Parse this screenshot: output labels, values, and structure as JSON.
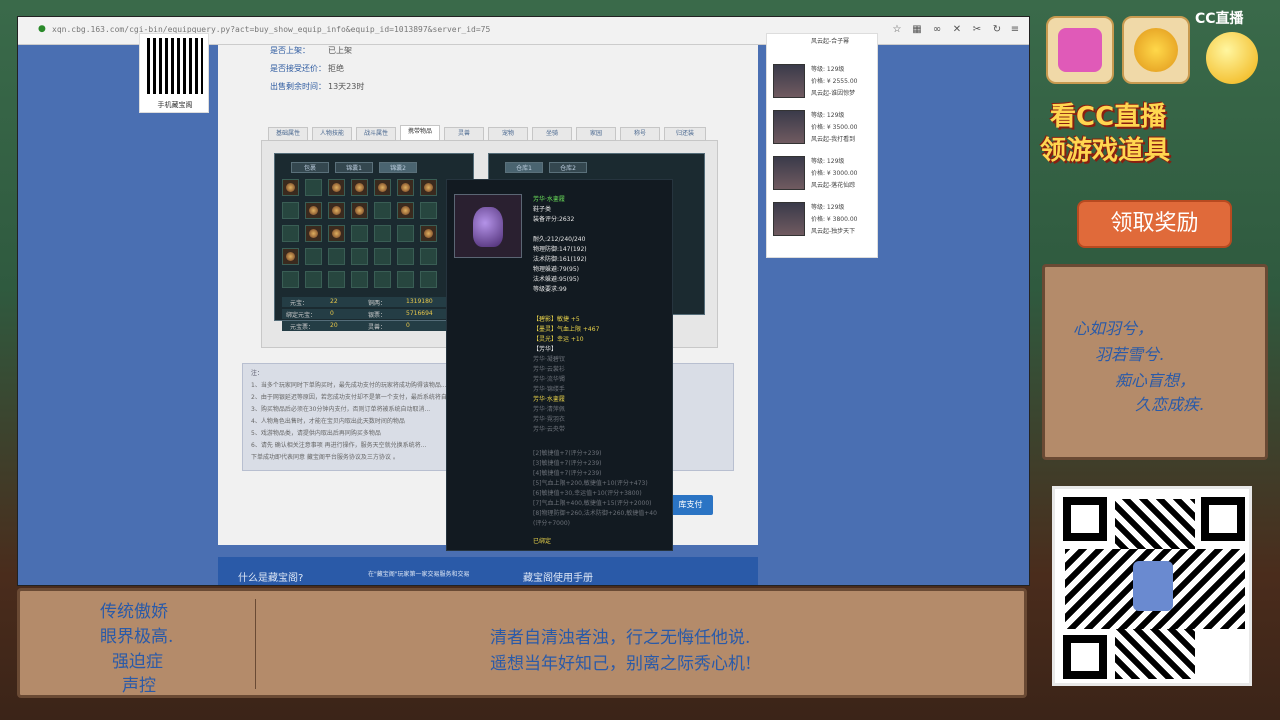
{
  "browser": {
    "url": "xqn.cbg.163.com/cgi-bin/equipquery.py?act=buy_show_equip_info&equip_id=1013897&server_id=75",
    "qr_caption": "手机藏宝阁"
  },
  "sale_info": [
    {
      "key": "是否上架：",
      "value": "已上架"
    },
    {
      "key": "是否接受还价：",
      "value": "拒绝"
    },
    {
      "key": "出售剩余时间：",
      "value": "13天23时"
    }
  ],
  "top_tabs": [
    "基础属性",
    "人物技能",
    "战斗属性",
    "携带物品",
    "灵兽",
    "宠物",
    "坐骑",
    "家园",
    "称号",
    "归还装"
  ],
  "active_tab": "携带物品",
  "inv_tabs": [
    "包裹",
    "锦囊1",
    "锦囊2"
  ],
  "store_tabs": [
    "仓库1",
    "仓库2"
  ],
  "stats": [
    {
      "k1": "元宝：",
      "v1": "22",
      "k2": "铜两：",
      "v2": "1319180"
    },
    {
      "k1": "绑定元宝：",
      "v1": "0",
      "k2": "银票：",
      "v2": "5716694"
    },
    {
      "k1": "元宝票：",
      "v1": "20",
      "k2": "灵兽：",
      "v2": "0"
    }
  ],
  "notes": {
    "title": "注：",
    "lines": [
      "1、当多个玩家同时下单购买时，最先成功支付的玩家将成功购得该物品...",
      "2、由于网银延迟等原因，若您成功支付却不是第一个支付，最后系统将自动退款到您的账户中",
      "3、购买物品后必须在30分钟内支付，否则订单将被系统自动取消...",
      "4、人物角色出售时，才能在宝贝内取出此天数时间的物品",
      "5、戏游物品类，请提供内取出后再同购买多物品",
      "6、请先 确认相关注意事项 再进行操作，服务天空就兑换系统将...",
      "下单成功即代表同意 藏宝阁平台服务协议及三方协议 。"
    ]
  },
  "pay_button": "库支付",
  "bottom_strip": [
    "什么是藏宝阁?",
    "在\"藏宝阁\"玩家第一家交易服务和交易",
    "藏宝阁使用手册"
  ],
  "tooltip": {
    "name": "芳华·水銮履",
    "type": "鞋子类",
    "score": "装备评分:2632",
    "base": [
      "耐久:212/240/240",
      "物理防御:147(192)",
      "法术防御:161(192)",
      "物理躲避:79(95)",
      "法术躲避:95(95)",
      "等级要求:99"
    ],
    "gems": [
      "【碧影】敏捷 +5",
      "【墨灵】气血上限 +467",
      "【灵光】幸运 +10"
    ],
    "set_title": "【芳华】",
    "set_items": [
      "芳华·凝碧钗",
      "芳华·云裳衫",
      "芳华·流华镯",
      "芳华·锦缕手",
      "芳华·水銮履",
      "芳华·清萍佩",
      "芳华·霓羽衣",
      "芳华·云央带"
    ],
    "active_set_item": "芳华·水銮履",
    "refine": [
      "[2]敏捷值+7(评分+239)",
      "[3]敏捷值+7(评分+239)",
      "[4]敏捷值+7(评分+239)",
      "[5]气血上限+200,敏捷值+10(评分+473)",
      "[6]敏捷值+30,幸运值+10(评分+3800)",
      "[7]气血上限+400,敏捷值+15(评分+2000)",
      "[8]物理防御+260,法术防御+260,敏捷值+40",
      "(评分+7000)"
    ],
    "bound": "已绑定"
  },
  "listings": [
    {
      "level": "等级: 129级",
      "price": "价格: ¥ 2555.00",
      "name": "风云起-谁因惊梦"
    },
    {
      "level": "等级: 129级",
      "price": "价格: ¥ 3500.00",
      "name": "风云起-我打看到"
    },
    {
      "level": "等级: 129级",
      "price": "价格: ¥ 3000.00",
      "name": "风云起-落花仙踪"
    },
    {
      "level": "等级: 129级",
      "price": "价格: ¥ 3800.00",
      "name": "风云起-独步天下"
    }
  ],
  "listing_top_name": "风云起-合子幂",
  "stream": {
    "logo": "CC直播",
    "promo": [
      "看CC直播",
      "领游戏道具"
    ],
    "claim": "领取奖励",
    "poem": [
      "心如羽兮，",
      "羽若雪兮.",
      "痴心盲想，",
      "久恋成疾."
    ],
    "left_tags": [
      "传统傲娇",
      "眼界极高.",
      "强迫症",
      "声控"
    ],
    "bottom_lines": [
      "清者自清浊者浊，行之无悔任他说.",
      "遥想当年好知己，别离之际秀心机!"
    ]
  },
  "colors": {
    "accent": "#2a5aa8",
    "frame": "#b48b6a",
    "tooltip_green": "#6be05a"
  }
}
